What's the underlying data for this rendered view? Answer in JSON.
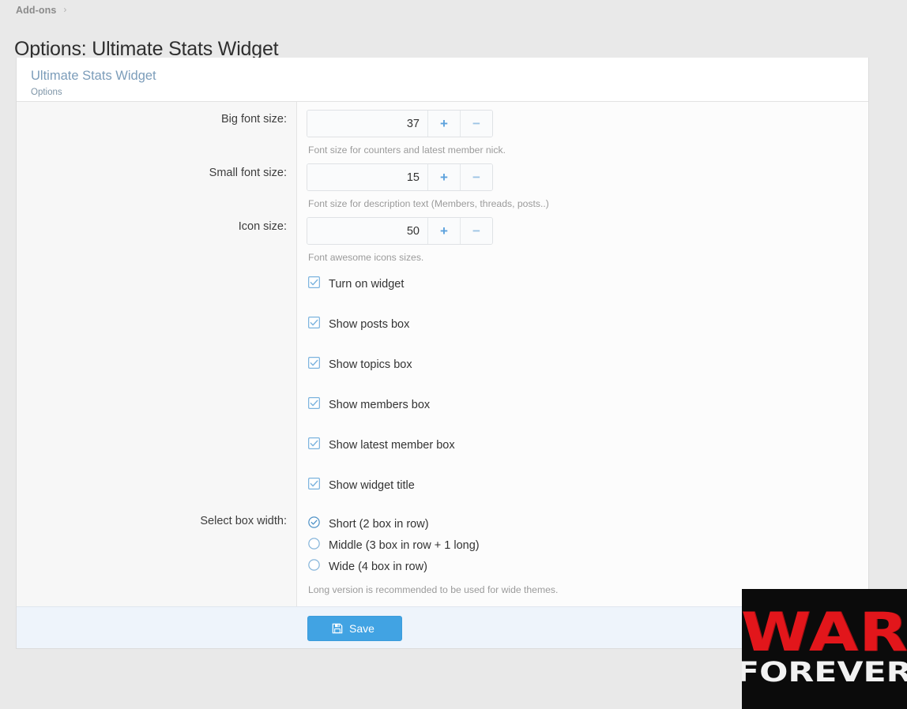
{
  "breadcrumb": {
    "items": [
      "Add-ons"
    ],
    "separator": "›"
  },
  "page_title": "Options: Ultimate Stats Widget",
  "card": {
    "title": "Ultimate Stats Widget",
    "subtitle": "Options"
  },
  "fields": {
    "big_font_size": {
      "label": "Big font size:",
      "value": "37",
      "plus": "+",
      "minus": "−",
      "hint": "Font size for counters and latest member nick."
    },
    "small_font_size": {
      "label": "Small font size:",
      "value": "15",
      "plus": "+",
      "minus": "−",
      "hint": "Font size for description text (Members, threads, posts..)"
    },
    "icon_size": {
      "label": "Icon size:",
      "value": "50",
      "plus": "+",
      "minus": "−",
      "hint": "Font awesome icons sizes."
    }
  },
  "checkboxes": [
    {
      "label": "Turn on widget",
      "checked": true
    },
    {
      "label": "Show posts box",
      "checked": true
    },
    {
      "label": "Show topics box",
      "checked": true
    },
    {
      "label": "Show members box",
      "checked": true
    },
    {
      "label": "Show latest member box",
      "checked": true
    },
    {
      "label": "Show widget title",
      "checked": true
    }
  ],
  "box_width": {
    "label": "Select box width:",
    "options": [
      {
        "label": "Short (2 box in row)",
        "selected": true
      },
      {
        "label": "Middle (3 box in row + 1 long)",
        "selected": false
      },
      {
        "label": "Wide (4 box in row)",
        "selected": false
      }
    ],
    "hint": "Long version is recommended to be used for wide themes."
  },
  "footer": {
    "save_label": "Save",
    "save_icon": "floppy-disk-icon"
  },
  "watermark": {
    "line1": "WAR",
    "line2": "FOREVER"
  },
  "colors": {
    "accent": "#41a3e3",
    "card_title": "#7c9dba",
    "footer_bg": "#eef4fb",
    "page_bg": "#e9e9e9",
    "watermark_red": "#e2161b"
  }
}
